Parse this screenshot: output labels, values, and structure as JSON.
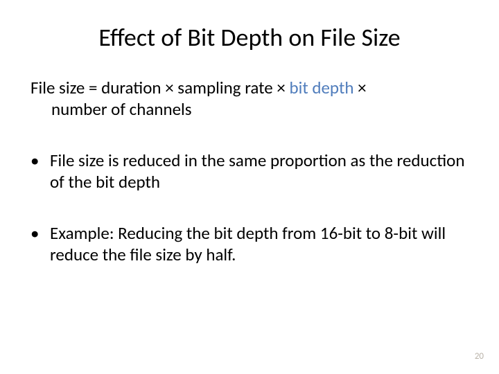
{
  "title": "Effect of Bit Depth on File Size",
  "formula": {
    "prefix": "File size = duration ",
    "times1": "×",
    "mid1": " sampling rate ",
    "times2": "×",
    "space1": " ",
    "highlight": "bit depth",
    "space2": " ",
    "times3": "×",
    "line2": "number of channels"
  },
  "bullets": [
    "File size is reduced in the same proportion as the reduction of the bit depth",
    "Example: Reducing the bit depth from 16-bit to 8-bit will reduce the file size by half."
  ],
  "bullet_marker": "•",
  "page_number": "20"
}
